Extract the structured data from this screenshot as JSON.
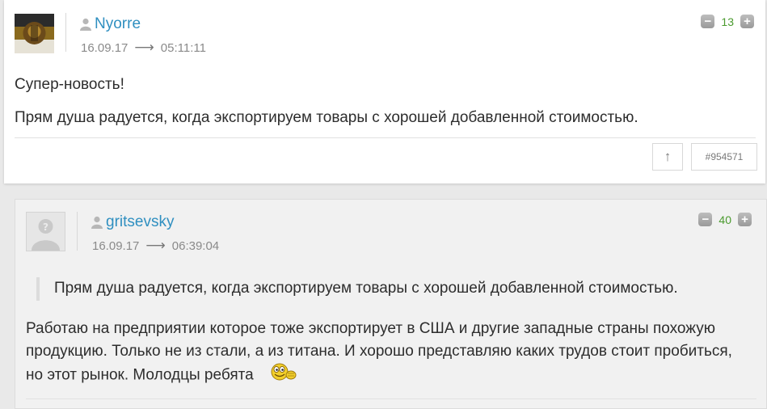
{
  "comments": [
    {
      "author": "Nyorre",
      "date": "16.09.17",
      "time": "05:11:11",
      "votes": "13",
      "paragraphs": [
        "Супер-новость!",
        "Прям душа радуется, когда экспортируем товары с хорошей добавленной стоимостью."
      ],
      "id_label": "#954571",
      "up_label": "↑"
    },
    {
      "author": "gritsevsky",
      "date": "16.09.17",
      "time": "06:39:04",
      "votes": "40",
      "quote": "Прям душа радуется, когда экспортируем товары с хорошей добавленной стоимостью.",
      "text": "Работаю на предприятии которое тоже экспортирует в США и другие западные страны похожую продукцию. Только не из стали, а из титана. И хорошо представляю каких трудов стоит пробиться, но этот рынок. Молодцы ребята"
    }
  ],
  "icons": {
    "user": "user-icon",
    "arrow": "arrow-right-icon",
    "minus": "minus-icon",
    "plus": "plus-icon",
    "smiley": "smiley-icon"
  },
  "colors": {
    "author": "#2f8fc0",
    "votes": "#4a9a2e"
  }
}
